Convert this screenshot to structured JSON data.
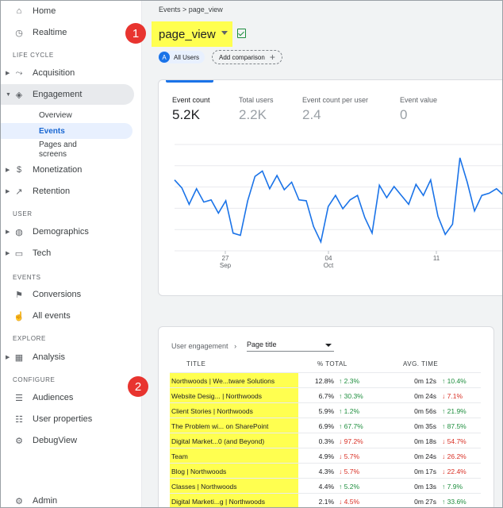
{
  "sidebar": {
    "home": "Home",
    "realtime": "Realtime",
    "section_lifecycle": "LIFE CYCLE",
    "acquisition": "Acquisition",
    "engagement": "Engagement",
    "overview": "Overview",
    "events": "Events",
    "pages_screens_1": "Pages and",
    "pages_screens_2": "screens",
    "monetization": "Monetization",
    "retention": "Retention",
    "section_user": "USER",
    "demographics": "Demographics",
    "tech": "Tech",
    "section_events": "EVENTS",
    "conversions": "Conversions",
    "all_events": "All events",
    "section_explore": "EXPLORE",
    "analysis": "Analysis",
    "section_configure": "CONFIGURE",
    "audiences": "Audiences",
    "user_properties": "User properties",
    "debugview": "DebugView",
    "admin": "Admin"
  },
  "header": {
    "breadcrumb": "Events  >  page_view",
    "title": "page_view",
    "badge1": "1",
    "badge2": "2",
    "segment_initial": "A",
    "segment_label": "All Users",
    "add_comparison": "Add comparison"
  },
  "metrics": [
    {
      "label": "Event count",
      "value": "5.2K"
    },
    {
      "label": "Total users",
      "value": "2.2K"
    },
    {
      "label": "Event count per user",
      "value": "2.4"
    },
    {
      "label": "Event value",
      "value": "0"
    }
  ],
  "chart_data": {
    "type": "line",
    "x_tick_labels": [
      {
        "day": "27",
        "month": "Sep"
      },
      {
        "day": "04",
        "month": "Oct"
      },
      {
        "day": "11",
        "month": ""
      }
    ],
    "values": [
      260,
      242,
      205,
      240,
      210,
      215,
      185,
      213,
      140,
      135,
      213,
      268,
      280,
      240,
      270,
      238,
      255,
      215,
      213,
      155,
      120,
      200,
      225,
      195,
      215,
      225,
      175,
      140,
      248,
      220,
      245,
      225,
      205,
      250,
      225,
      260,
      178,
      137,
      160,
      310,
      255,
      190,
      225,
      230,
      240,
      225
    ],
    "series_color": "#1a73e8",
    "grid": true
  },
  "table": {
    "dimension_prefix": "User engagement",
    "dimension_select": "Page title",
    "col_title": "TITLE",
    "col_total": "% TOTAL",
    "col_time": "AVG. TIME",
    "rows": [
      {
        "title": "Northwoods | We...tware Solutions",
        "pct": "12.8%",
        "pct_change": "2.3%",
        "pct_dir": "up",
        "time": "0m 12s",
        "time_change": "10.4%",
        "time_dir": "up"
      },
      {
        "title": "Website Desig... | Northwoods",
        "pct": "6.7%",
        "pct_change": "30.3%",
        "pct_dir": "up",
        "time": "0m 24s",
        "time_change": "7.1%",
        "time_dir": "down"
      },
      {
        "title": "Client Stories | Northwoods",
        "pct": "5.9%",
        "pct_change": "1.2%",
        "pct_dir": "up",
        "time": "0m 56s",
        "time_change": "21.9%",
        "time_dir": "up"
      },
      {
        "title": "The Problem wi... on SharePoint",
        "pct": "6.9%",
        "pct_change": "67.7%",
        "pct_dir": "up",
        "time": "0m 35s",
        "time_change": "87.5%",
        "time_dir": "up"
      },
      {
        "title": "Digital Market...0 (and Beyond)",
        "pct": "0.3%",
        "pct_change": "97.2%",
        "pct_dir": "down",
        "time": "0m 18s",
        "time_change": "54.7%",
        "time_dir": "down"
      },
      {
        "title": "Team",
        "pct": "4.9%",
        "pct_change": "5.7%",
        "pct_dir": "down",
        "time": "0m 24s",
        "time_change": "26.2%",
        "time_dir": "down"
      },
      {
        "title": "Blog | Northwoods",
        "pct": "4.3%",
        "pct_change": "5.7%",
        "pct_dir": "down",
        "time": "0m 17s",
        "time_change": "22.4%",
        "time_dir": "down"
      },
      {
        "title": "Classes | Northwoods",
        "pct": "4.4%",
        "pct_change": "5.2%",
        "pct_dir": "up",
        "time": "0m 13s",
        "time_change": "7.9%",
        "time_dir": "up"
      },
      {
        "title": "Digital Marketi...g | Northwoods",
        "pct": "2.1%",
        "pct_change": "4.5%",
        "pct_dir": "down",
        "time": "0m 27s",
        "time_change": "33.6%",
        "time_dir": "up"
      }
    ]
  }
}
